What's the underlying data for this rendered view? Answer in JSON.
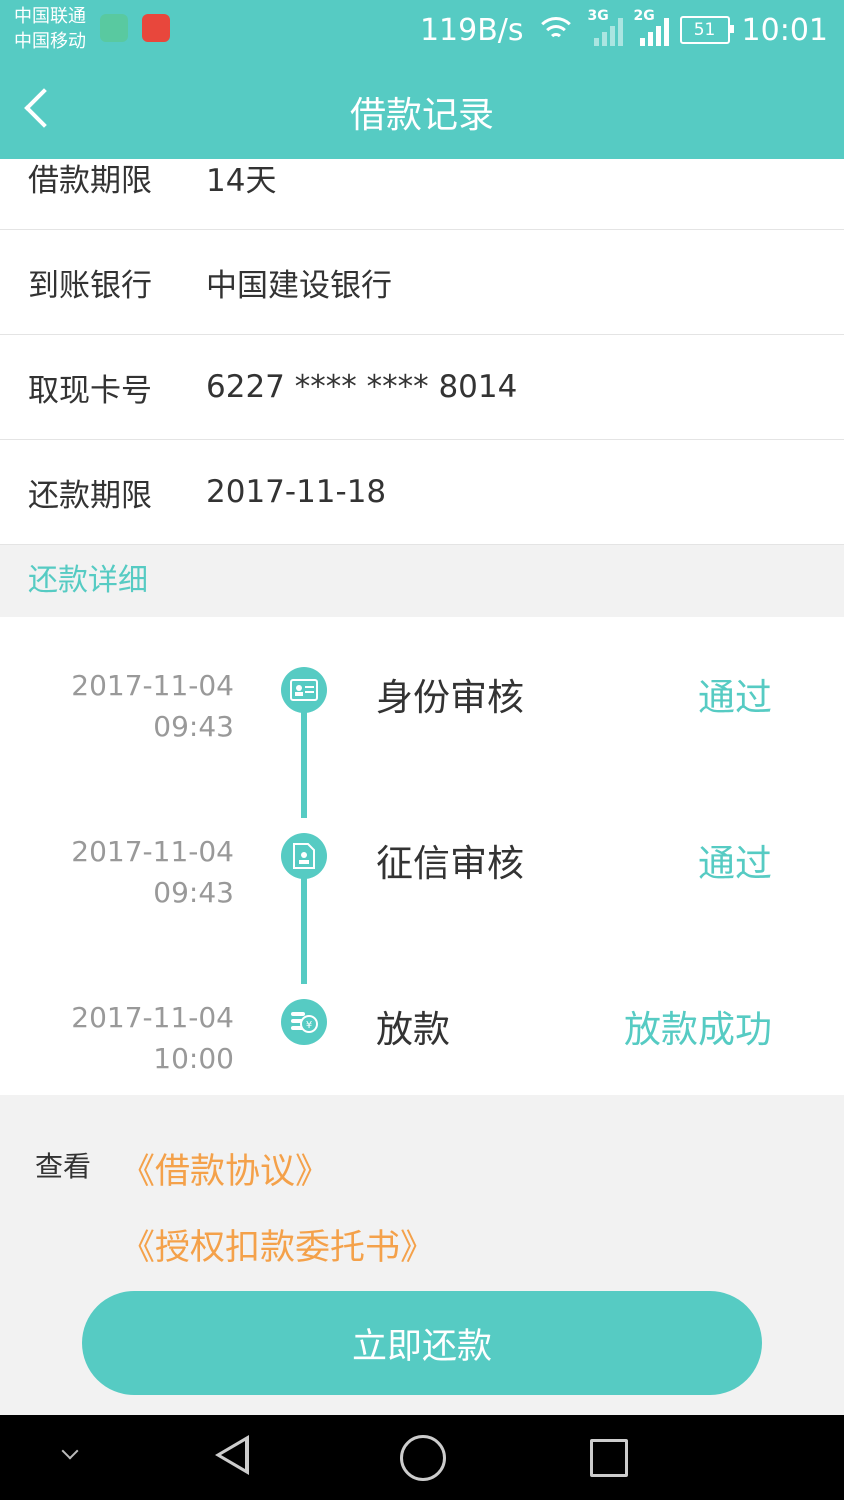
{
  "status_bar": {
    "carrier1": "中国联通",
    "carrier2": "中国移动",
    "net_speed": "119B/s",
    "signal1_label": "3G",
    "signal2_label": "2G",
    "battery": "51",
    "time": "10:01"
  },
  "header": {
    "title": "借款记录"
  },
  "details": [
    {
      "key": "借款期限",
      "value": "14天"
    },
    {
      "key": "到账银行",
      "value": "中国建设银行"
    },
    {
      "key": "取现卡号",
      "value": "6227 **** **** 8014"
    },
    {
      "key": "还款期限",
      "value": "2017-11-18"
    }
  ],
  "section": {
    "title": "还款详细"
  },
  "timeline": [
    {
      "date": "2017-11-04",
      "time": "09:43",
      "name": "身份审核",
      "status": "通过",
      "icon": "id-card-icon"
    },
    {
      "date": "2017-11-04",
      "time": "09:43",
      "name": "征信审核",
      "status": "通过",
      "icon": "credit-report-icon"
    },
    {
      "date": "2017-11-04",
      "time": "10:00",
      "name": "放款",
      "status": "放款成功",
      "icon": "coins-yuan-icon"
    }
  ],
  "documents": {
    "view_label": "查看",
    "links": [
      "《借款协议》",
      "《授权扣款委托书》"
    ]
  },
  "actions": {
    "repay": "立即还款"
  },
  "colors": {
    "accent": "#56cbc3",
    "link": "#f4a14a"
  }
}
